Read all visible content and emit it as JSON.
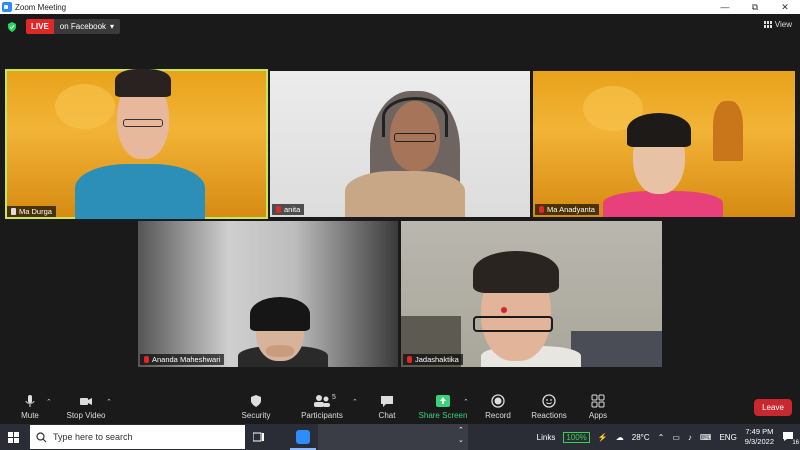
{
  "window": {
    "title": "Zoom Meeting",
    "controls": [
      "minimize",
      "maximize",
      "close"
    ]
  },
  "meeting": {
    "live_badge": "LIVE",
    "live_destination": "on Facebook",
    "view_label": "View",
    "participants": [
      {
        "name": "Ma Durga",
        "muted": false,
        "pinned": true,
        "active_speaker": true
      },
      {
        "name": "anita",
        "muted": true,
        "pinned": false,
        "active_speaker": false
      },
      {
        "name": "Ma Anadyanta",
        "muted": true,
        "pinned": false,
        "active_speaker": false
      },
      {
        "name": "Ananda Maheshwari",
        "muted": true,
        "pinned": false,
        "active_speaker": false
      },
      {
        "name": "Jadashaktika",
        "muted": true,
        "pinned": false,
        "active_speaker": false
      }
    ]
  },
  "toolbar": {
    "mute": "Mute",
    "stop_video": "Stop Video",
    "security": "Security",
    "participants": "Participants",
    "participants_count": "5",
    "chat": "Chat",
    "share_screen": "Share Screen",
    "record": "Record",
    "reactions": "Reactions",
    "apps": "Apps",
    "leave": "Leave"
  },
  "taskbar": {
    "search_placeholder": "Type here to search",
    "links": "Links",
    "battery": "100%",
    "weather": "28°C",
    "language": "ENG",
    "time": "7:49 PM",
    "date": "9/3/2022",
    "notifications": "16"
  },
  "colors": {
    "live_red": "#e02828",
    "active_speaker": "#c8e65a",
    "share_green": "#38d27a",
    "leave_red": "#c8282f",
    "zoom_blue": "#2d8cff"
  }
}
